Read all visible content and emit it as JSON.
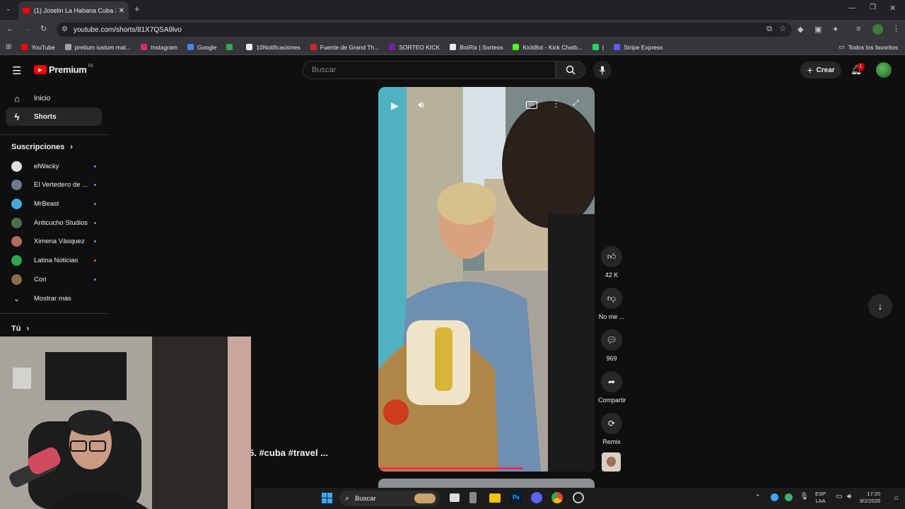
{
  "browser": {
    "tab_title": "(1) Joselin La Habana Cuba 202",
    "url": "youtube.com/shorts/81X7QSA9lvo",
    "bookmarks": [
      {
        "label": "YouTube",
        "color": "#ff0000"
      },
      {
        "label": "pretium iustum mat...",
        "color": "#9aa0a6"
      },
      {
        "label": "Instagram",
        "color": "#d62976"
      },
      {
        "label": "Google",
        "color": "#4285f4"
      },
      {
        "label": "",
        "color": "#34a853"
      },
      {
        "label": "10Notificaciones",
        "color": "#e8eaed"
      },
      {
        "label": "Fuente de Grand Th...",
        "color": "#c62828"
      },
      {
        "label": "SORTEO KICK",
        "color": "#7b1fa2"
      },
      {
        "label": "BotRix | Sorteos",
        "color": "#e8eaed"
      },
      {
        "label": "KickBot - Kick Chatb...",
        "color": "#53fc18"
      },
      {
        "label": "|",
        "color": "#25d366"
      },
      {
        "label": "Stripe Express",
        "color": "#635bff"
      }
    ],
    "all_bookmarks_label": "Todos los favoritos"
  },
  "header": {
    "logo_text": "Premium",
    "country": "PE",
    "search_placeholder": "Buscar",
    "create_label": "Crear",
    "notification_count": "1"
  },
  "sidebar": {
    "nav": [
      {
        "label": "Inicio",
        "icon": "home-icon"
      },
      {
        "label": "Shorts",
        "icon": "shorts-icon"
      }
    ],
    "subscriptions_title": "Suscripciones",
    "subscriptions": [
      {
        "name": "elWacky",
        "color": "#e0e0e0"
      },
      {
        "name": "El Vertedero de ...",
        "color": "#6d7b8d"
      },
      {
        "name": "MrBeast",
        "color": "#45a8d8"
      },
      {
        "name": "Anticucho Studios",
        "color": "#4a6e4a"
      },
      {
        "name": "Ximena Vásquez",
        "color": "#b36b5e"
      },
      {
        "name": "Latina Noticias",
        "color": "#2fa84f"
      },
      {
        "name": "Cori",
        "color": "#8a6d4a"
      }
    ],
    "show_more": "Mostrar más",
    "you_title": "Tú"
  },
  "short": {
    "actions": [
      {
        "label": "42 K",
        "icon": "like-icon"
      },
      {
        "label": "No me ...",
        "icon": "dislike-icon"
      },
      {
        "label": "969",
        "icon": "comment-icon"
      },
      {
        "label": "Compartir",
        "icon": "share-icon"
      },
      {
        "label": "Remix",
        "icon": "remix-icon"
      }
    ],
    "title_overlay": "5. #cuba #travel ..."
  },
  "taskbar": {
    "search_label": "Buscar",
    "lang": "ESP",
    "lang2": "LAA",
    "time": "17:20",
    "date": "9/2/2026"
  }
}
